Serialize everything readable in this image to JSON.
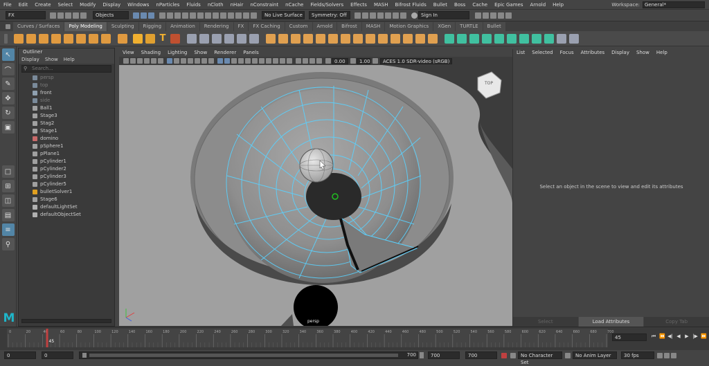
{
  "menubar": {
    "items": [
      "File",
      "Edit",
      "Create",
      "Select",
      "Modify",
      "Display",
      "Windows",
      "nParticles",
      "Fluids",
      "nCloth",
      "nHair",
      "nConstraint",
      "nCache",
      "Fields/Solvers",
      "Effects",
      "MASH",
      "Bifrost Fluids",
      "Bullet",
      "Boss",
      "Cache",
      "Epic Games",
      "Arnold",
      "Help"
    ],
    "workspace_label": "Workspace:",
    "workspace_value": "General*"
  },
  "statusline": {
    "menuset": "FX",
    "selection_mode": "Objects",
    "live_surface": "No Live Surface",
    "symmetry": "Symmetry: Off",
    "sign_in": "Sign In"
  },
  "shelf": {
    "tabs": [
      "Curves / Surfaces",
      "Poly Modeling",
      "Sculpting",
      "Rigging",
      "Animation",
      "Rendering",
      "FX",
      "FX Caching",
      "Custom",
      "Arnold",
      "Bifrost",
      "MASH",
      "Motion Graphics",
      "XGen",
      "TURTLE",
      "Bullet"
    ],
    "active_tab": 1,
    "text_tool_glyph": "T"
  },
  "outliner": {
    "title": "Outliner",
    "menu": [
      "Display",
      "Show",
      "Help"
    ],
    "search_placeholder": "Search...",
    "items": [
      {
        "label": "persp",
        "dim": true,
        "color": "#7a8a9a"
      },
      {
        "label": "top",
        "dim": true,
        "color": "#7a8a9a"
      },
      {
        "label": "front",
        "dim": false,
        "color": "#8fa0b0"
      },
      {
        "label": "side",
        "dim": true,
        "color": "#7a8a9a"
      },
      {
        "label": "Ball1",
        "dim": false,
        "color": "#a0a0a0"
      },
      {
        "label": "Stage3",
        "dim": false,
        "color": "#a0a0a0"
      },
      {
        "label": "Stag2",
        "dim": false,
        "color": "#a0a0a0"
      },
      {
        "label": "Stage1",
        "dim": false,
        "color": "#a0a0a0"
      },
      {
        "label": "domino",
        "dim": false,
        "color": "#c86a6a"
      },
      {
        "label": "pSphere1",
        "dim": false,
        "color": "#a0a0a0"
      },
      {
        "label": "pPlane1",
        "dim": false,
        "color": "#a0a0a0"
      },
      {
        "label": "pCylinder1",
        "dim": false,
        "color": "#a0a0a0"
      },
      {
        "label": "pCylinder2",
        "dim": false,
        "color": "#a0a0a0"
      },
      {
        "label": "pCylinder3",
        "dim": false,
        "color": "#a0a0a0"
      },
      {
        "label": "pCylinder5",
        "dim": false,
        "color": "#a0a0a0"
      },
      {
        "label": "bulletSolver1",
        "dim": false,
        "color": "#e0a020"
      },
      {
        "label": "Stage6",
        "dim": false,
        "color": "#a0a0a0"
      },
      {
        "label": "defaultLightSet",
        "dim": false,
        "color": "#b0b0b0"
      },
      {
        "label": "defaultObjectSet",
        "dim": false,
        "color": "#b0b0b0"
      }
    ]
  },
  "viewport": {
    "menu": [
      "View",
      "Shading",
      "Lighting",
      "Show",
      "Renderer",
      "Panels"
    ],
    "exposure": "0.00",
    "gamma": "1.00",
    "colorspace": "ACES 1.0 SDR-video (sRGB)",
    "camera_label": "persp",
    "viewcube_label": "TOP"
  },
  "attribute_editor": {
    "menu": [
      "List",
      "Selected",
      "Focus",
      "Attributes",
      "Display",
      "Show",
      "Help"
    ],
    "message": "Select an object in the scene to view and edit its attributes",
    "buttons": [
      "Select",
      "Load Attributes",
      "Copy Tab"
    ]
  },
  "timeline": {
    "ticks": [
      0,
      20,
      40,
      60,
      80,
      100,
      120,
      140,
      160,
      180,
      200,
      220,
      240,
      260,
      280,
      300,
      320,
      340,
      360,
      380,
      400,
      420,
      440,
      460,
      480,
      500,
      520,
      540,
      560,
      580,
      600,
      620,
      640,
      660,
      680,
      700
    ],
    "current_frame": "45",
    "current_frame_field": "45"
  },
  "range": {
    "start": "0",
    "playback_start": "0",
    "playback_end": "700",
    "range_end_label": "700",
    "end": "700",
    "anim_end": "700",
    "character_set": "No Character Set",
    "anim_layer": "No Anim Layer",
    "fps": "30 fps"
  },
  "colors": {
    "accent": "#5285a6",
    "wire": "#5ad2ff",
    "maya_logo": "#1fb5c9"
  }
}
